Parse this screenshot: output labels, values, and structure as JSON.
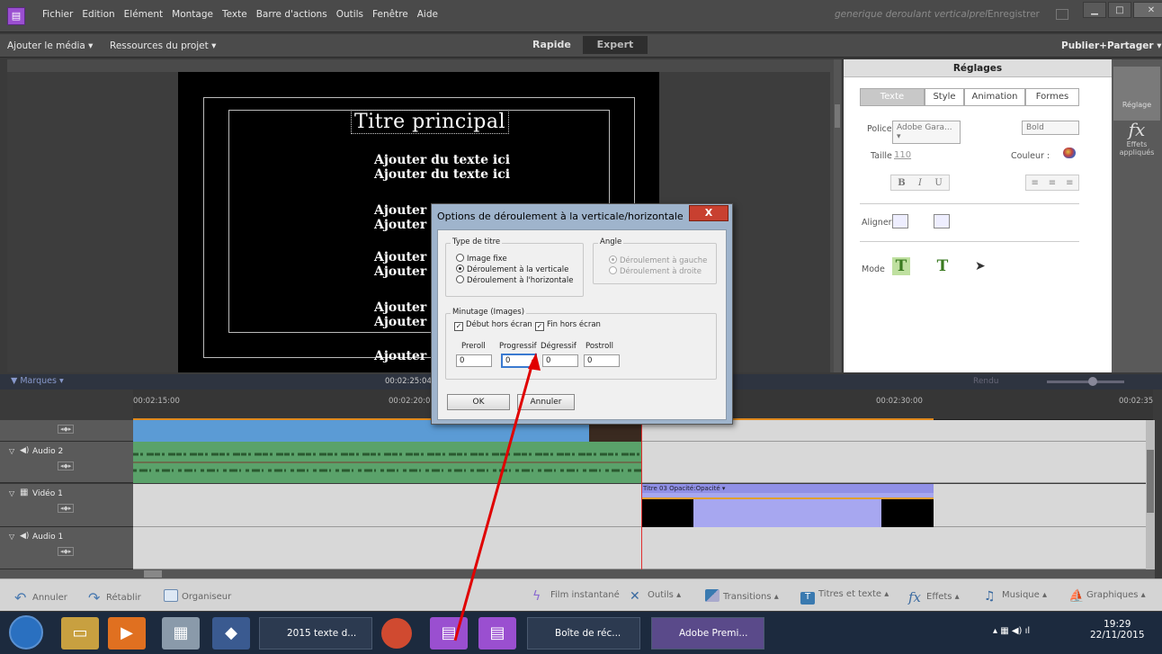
{
  "menubar": {
    "items": [
      "Fichier",
      "Edition",
      "Elément",
      "Montage",
      "Texte",
      "Barre d'actions",
      "Outils",
      "Fenêtre",
      "Aide"
    ],
    "project_title": "generique deroulant verticalprel",
    "save_label": "Enregistrer"
  },
  "toolbar": {
    "add_media": "Ajouter le média ▾",
    "project_resources": "Ressources du projet ▾",
    "mode_rapide": "Rapide",
    "mode_expert": "Expert",
    "publish": "Publier+Partager ▾"
  },
  "monitor": {
    "title_main": "Titre principal",
    "lines": [
      "Ajouter du texte ici",
      "Ajouter du texte ici",
      "Ajouter",
      "Ajouter",
      "Ajouter",
      "Ajouter",
      "Ajouter",
      "Ajouter",
      "Ajouter"
    ]
  },
  "settings": {
    "header": "Réglages",
    "tabs": [
      "Texte",
      "Style",
      "Animation",
      "Formes"
    ],
    "police_label": "Police",
    "police_value": "Adobe Gara... ▾",
    "weight_value": "Bold",
    "taille_label": "Taille",
    "taille_value": "110",
    "couleur_label": "Couleur :",
    "bold": "B",
    "italic": "I",
    "underline": "U",
    "aligner_label": "Aligner",
    "mode_label": "Mode"
  },
  "right_strip": {
    "reglage": "Réglage",
    "effets": "Effets appliqués"
  },
  "timeline": {
    "markers_label": "Marques",
    "current_tc": "00:02:25:04",
    "rendu": "Rendu",
    "timecodes": [
      "00:02:15:00",
      "00:02:20:00",
      "00:02:30:00",
      "00:02:35"
    ],
    "tracks": [
      {
        "name": "Audio 2"
      },
      {
        "name": "Vidéo 1"
      },
      {
        "name": "Audio 1"
      }
    ],
    "clip_title_label": "Titre 03  Opacité:Opacité ▾"
  },
  "actions": {
    "undo": "Annuler",
    "redo": "Rétablir",
    "organizer": "Organiseur",
    "instant_movie": "Film instantané",
    "tools": "Outils",
    "transitions": "Transitions",
    "titles": "Titres et texte",
    "effects": "Effets",
    "music": "Musique",
    "graphics": "Graphiques"
  },
  "dialog": {
    "title": "Options de déroulement à la verticale/horizontale",
    "close": "X",
    "type_group": "Type de titre",
    "type_options": [
      "Image fixe",
      "Déroulement à la verticale",
      "Déroulement à l'horizontale"
    ],
    "type_selected": 1,
    "angle_group": "Angle",
    "angle_options": [
      "Déroulement à gauche",
      "Déroulement à droite"
    ],
    "timing_group": "Minutage (Images)",
    "start_offscreen": "Début hors écran",
    "end_offscreen": "Fin hors écran",
    "fields": [
      {
        "label": "Preroll",
        "value": "0"
      },
      {
        "label": "Progressif",
        "value": "0"
      },
      {
        "label": "Dégressif",
        "value": "0"
      },
      {
        "label": "Postroll",
        "value": "0"
      }
    ],
    "ok": "OK",
    "cancel": "Annuler"
  },
  "taskbar": {
    "tasks": [
      "2015 texte d...",
      "Boîte de réc...",
      "Adobe Premi..."
    ],
    "time": "19:29",
    "date": "22/11/2015"
  },
  "colors": {
    "accent_purple": "#9a4fd0",
    "annotation_red": "#e00000",
    "audio_clip": "#5aa26a",
    "title_clip": "#a7a7f0"
  }
}
